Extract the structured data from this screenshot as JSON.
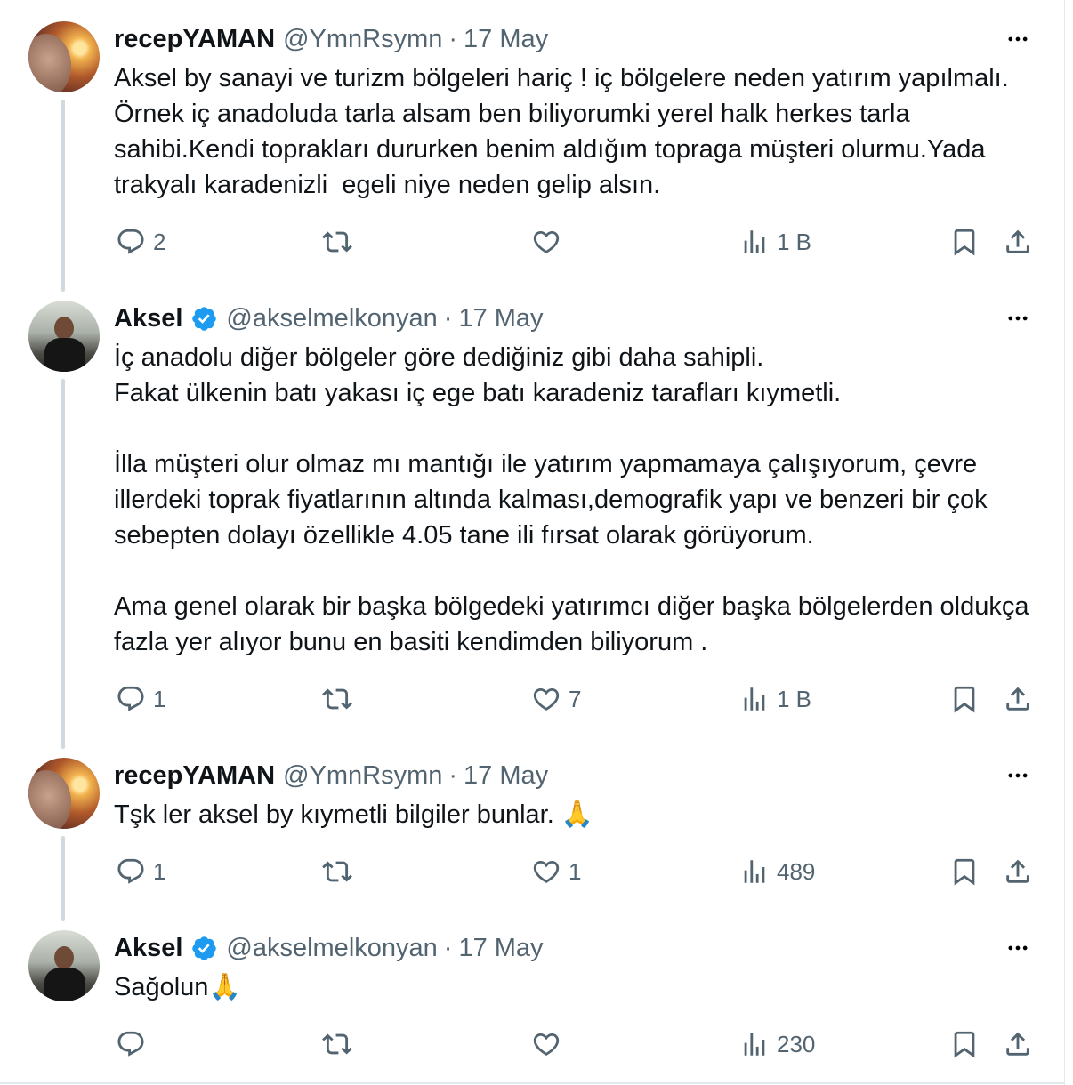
{
  "tweets": [
    {
      "author": "recepYAMAN",
      "handle": "@YmnRsymn",
      "separator": "·",
      "date": "17 May",
      "text": "Aksel by sanayi ve turizm bölgeleri hariç ! iç bölgelere neden yatırım yapılmalı. Örnek iç anadoluda tarla alsam ben biliyorumki yerel halk herkes tarla sahibi.Kendi toprakları dururken benim aldığım topraga müşteri olurmu.Yada trakyalı karadenizli  egeli niye neden gelip alsın.",
      "replies": "2",
      "reposts": "",
      "likes": "",
      "views": "1 B"
    },
    {
      "author": "Aksel",
      "handle": "@akselmelkonyan",
      "separator": "·",
      "date": "17 May",
      "text": "İç anadolu diğer bölgeler göre dediğiniz gibi daha sahipli.\nFakat ülkenin batı yakası iç ege batı karadeniz tarafları kıymetli.\n\nİlla müşteri olur olmaz mı mantığı ile yatırım yapmamaya çalışıyorum, çevre illerdeki toprak fiyatlarının altında kalması,demografik yapı ve benzeri bir çok sebepten dolayı özellikle 4.05 tane ili fırsat olarak görüyorum.\n\nAma genel olarak bir başka bölgedeki yatırımcı diğer başka bölgelerden oldukça fazla yer alıyor bunu en basiti kendimden biliyorum .",
      "replies": "1",
      "reposts": "",
      "likes": "7",
      "views": "1 B"
    },
    {
      "author": "recepYAMAN",
      "handle": "@YmnRsymn",
      "separator": "·",
      "date": "17 May",
      "text": "Tşk ler aksel by kıymetli bilgiler bunlar. ",
      "emoji": "🙏",
      "replies": "1",
      "reposts": "",
      "likes": "1",
      "views": "489"
    },
    {
      "author": "Aksel",
      "handle": "@akselmelkonyan",
      "separator": "·",
      "date": "17 May",
      "text": "Sağolun",
      "emoji": "🙏",
      "replies": "",
      "reposts": "",
      "likes": "",
      "views": "230"
    }
  ],
  "colors": {
    "text": "#0f1419",
    "secondary": "#536471",
    "verified": "#1d9bf0",
    "thread_line": "#cfd9de"
  },
  "icons": [
    "reply-icon",
    "repost-icon",
    "like-icon",
    "views-icon",
    "bookmark-icon",
    "share-icon",
    "more-icon",
    "verified-badge-icon"
  ]
}
